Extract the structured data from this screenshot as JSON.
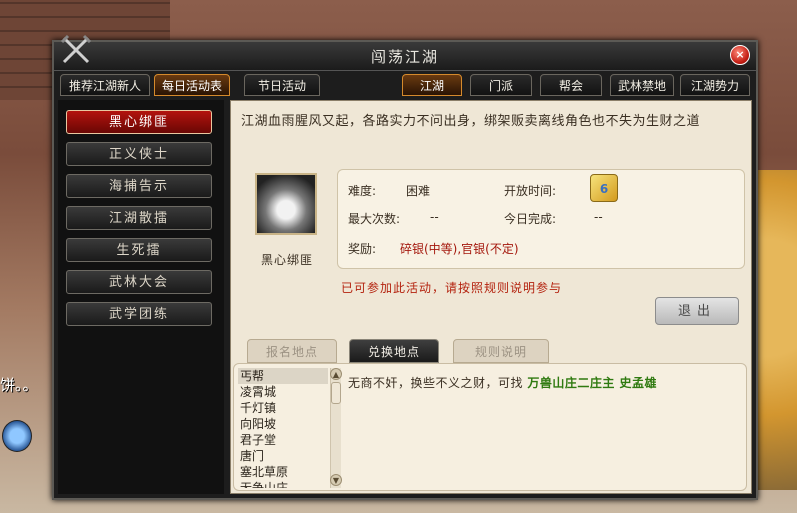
{
  "background": {
    "left_text": "饼。。"
  },
  "window": {
    "title": "闯荡江湖",
    "close_label": "×",
    "tabs": [
      {
        "label": "推荐江湖新人",
        "active": false
      },
      {
        "label": "每日活动表",
        "active": true
      },
      {
        "label": "节日活动",
        "active": false
      },
      {
        "label": "江湖",
        "active": true
      },
      {
        "label": "门派",
        "active": false
      },
      {
        "label": "帮会",
        "active": false
      },
      {
        "label": "武林禁地",
        "active": false
      },
      {
        "label": "江湖势力",
        "active": false
      }
    ]
  },
  "sidebar": {
    "items": [
      {
        "label": "黑心绑匪",
        "active": true
      },
      {
        "label": "正义侠士",
        "active": false
      },
      {
        "label": "海捕告示",
        "active": false
      },
      {
        "label": "江湖散擂",
        "active": false
      },
      {
        "label": "生死擂",
        "active": false
      },
      {
        "label": "武林大会",
        "active": false
      },
      {
        "label": "武学团练",
        "active": false
      }
    ]
  },
  "detail": {
    "intro": "江湖血雨腥风又起，各路实力不问出身，绑架贩卖离线角色也不失为生财之道",
    "activity_name": "黑心绑匪",
    "difficulty_label": "难度:",
    "difficulty_value": "困难",
    "open_time_label": "开放时间:",
    "calendar_day": "6",
    "max_times_label": "最大次数:",
    "max_times_value": "--",
    "today_done_label": "今日完成:",
    "today_done_value": "--",
    "reward_label": "奖励:",
    "reward_value": "碎银(中等),官银(不定)",
    "notice": "已可参加此活动，请按照规则说明参与",
    "exit_label": "退出"
  },
  "subtabs": [
    {
      "label": "报名地点",
      "active": false
    },
    {
      "label": "兑换地点",
      "active": true
    },
    {
      "label": "规则说明",
      "active": false
    }
  ],
  "places": [
    "丐帮",
    "凌霄城",
    "千灯镇",
    "向阳坡",
    "君子堂",
    "唐门",
    "塞北草原",
    "无争山庄"
  ],
  "exchange": {
    "text": "无商不奸，换些不义之财，可找",
    "npc": "万兽山庄二庄主 史孟雄"
  },
  "colors": {
    "active_tab": "#d58a2c",
    "active_side": "#b3130e",
    "reward_red": "#a4170c",
    "npc_green": "#2f7a10"
  }
}
